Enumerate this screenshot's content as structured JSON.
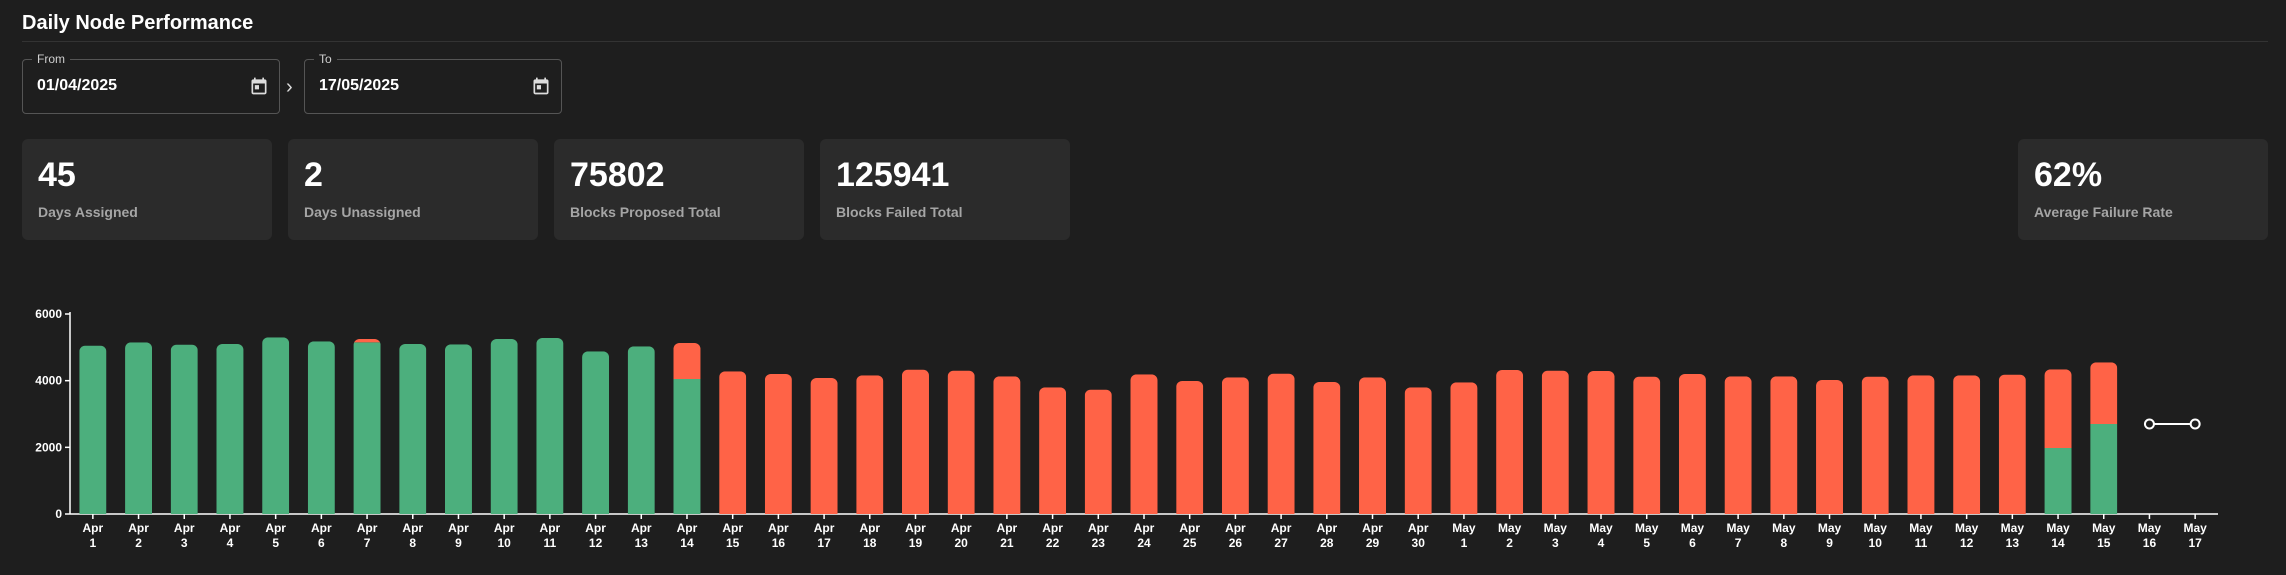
{
  "header": {
    "title": "Daily Node Performance"
  },
  "filters": {
    "from": {
      "label": "From",
      "value": "01/04/2025"
    },
    "to": {
      "label": "To",
      "value": "17/05/2025"
    },
    "separator": "›"
  },
  "stats": [
    {
      "value": "45",
      "label": "Days Assigned"
    },
    {
      "value": "2",
      "label": "Days Unassigned"
    },
    {
      "value": "75802",
      "label": "Blocks Proposed Total"
    },
    {
      "value": "125941",
      "label": "Blocks Failed Total"
    },
    {
      "value": "62%",
      "label": "Average Failure Rate"
    }
  ],
  "colors": {
    "proposed": "#4caf7d",
    "failed": "#ff6347",
    "background": "#1e1e1e",
    "card": "#2b2b2b"
  },
  "chart_data": {
    "type": "bar",
    "stacked": true,
    "ylim": [
      0,
      6000
    ],
    "yticks": [
      0,
      2000,
      4000,
      6000
    ],
    "categories": [
      [
        "Apr",
        "1"
      ],
      [
        "Apr",
        "2"
      ],
      [
        "Apr",
        "3"
      ],
      [
        "Apr",
        "4"
      ],
      [
        "Apr",
        "5"
      ],
      [
        "Apr",
        "6"
      ],
      [
        "Apr",
        "7"
      ],
      [
        "Apr",
        "8"
      ],
      [
        "Apr",
        "9"
      ],
      [
        "Apr",
        "10"
      ],
      [
        "Apr",
        "11"
      ],
      [
        "Apr",
        "12"
      ],
      [
        "Apr",
        "13"
      ],
      [
        "Apr",
        "14"
      ],
      [
        "Apr",
        "15"
      ],
      [
        "Apr",
        "16"
      ],
      [
        "Apr",
        "17"
      ],
      [
        "Apr",
        "18"
      ],
      [
        "Apr",
        "19"
      ],
      [
        "Apr",
        "20"
      ],
      [
        "Apr",
        "21"
      ],
      [
        "Apr",
        "22"
      ],
      [
        "Apr",
        "23"
      ],
      [
        "Apr",
        "24"
      ],
      [
        "Apr",
        "25"
      ],
      [
        "Apr",
        "26"
      ],
      [
        "Apr",
        "27"
      ],
      [
        "Apr",
        "28"
      ],
      [
        "Apr",
        "29"
      ],
      [
        "Apr",
        "30"
      ],
      [
        "May",
        "1"
      ],
      [
        "May",
        "2"
      ],
      [
        "May",
        "3"
      ],
      [
        "May",
        "4"
      ],
      [
        "May",
        "5"
      ],
      [
        "May",
        "6"
      ],
      [
        "May",
        "7"
      ],
      [
        "May",
        "8"
      ],
      [
        "May",
        "9"
      ],
      [
        "May",
        "10"
      ],
      [
        "May",
        "11"
      ],
      [
        "May",
        "12"
      ],
      [
        "May",
        "13"
      ],
      [
        "May",
        "14"
      ],
      [
        "May",
        "15"
      ],
      [
        "May",
        "16"
      ],
      [
        "May",
        "17"
      ]
    ],
    "series": [
      {
        "key": "proposed",
        "values": [
          5050,
          5150,
          5080,
          5100,
          5300,
          5180,
          5150,
          5100,
          5090,
          5250,
          5280,
          4880,
          5030,
          4050,
          0,
          0,
          0,
          0,
          0,
          0,
          0,
          0,
          0,
          0,
          0,
          0,
          0,
          0,
          0,
          0,
          0,
          0,
          0,
          0,
          0,
          0,
          0,
          0,
          0,
          0,
          0,
          0,
          0,
          1980,
          2700,
          null,
          null
        ]
      },
      {
        "key": "failed",
        "values": [
          0,
          0,
          0,
          0,
          0,
          0,
          100,
          0,
          0,
          0,
          0,
          0,
          0,
          1080,
          4280,
          4200,
          4080,
          4160,
          4330,
          4300,
          4130,
          3800,
          3730,
          4190,
          3990,
          4100,
          4210,
          3960,
          4100,
          3800,
          3950,
          4320,
          4300,
          4290,
          4120,
          4200,
          4130,
          4130,
          4020,
          4120,
          4160,
          4160,
          4180,
          2360,
          1850,
          null,
          null
        ]
      }
    ],
    "unassigned": [
      {
        "from": 45,
        "to": 46
      }
    ]
  }
}
